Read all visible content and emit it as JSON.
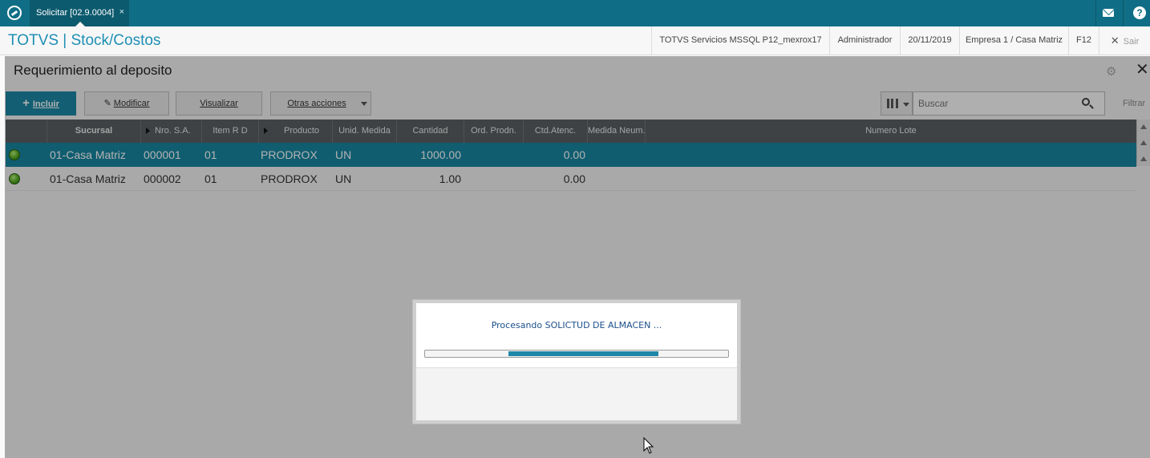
{
  "topbar": {
    "tab_label": "Solicitar [02.9.0004]",
    "tab_close": "×"
  },
  "header": {
    "app_title": "TOTVS | Stock/Costos",
    "environment": "TOTVS Servicios MSSQL P12_mexrox17",
    "user": "Administrador",
    "date": "20/11/2019",
    "company": "Empresa 1 / Casa Matriz",
    "shortcut": "F12",
    "exit_label": "Sair"
  },
  "page": {
    "title": "Requerimiento al deposito"
  },
  "toolbar": {
    "add_label": "Incluir",
    "modify_label": "Modificar",
    "view_label": "Visualizar",
    "more_label": "Otras acciones",
    "search_placeholder": "Buscar",
    "filter_label": "Filtrar"
  },
  "grid": {
    "columns": [
      "Sucursal",
      "Nro. S.A.",
      "Item R D",
      "Producto",
      "Unid. Medida",
      "Cantidad",
      "Ord. Prodn.",
      "Ctd.Atenc.",
      "Medida Neum.",
      "Numero Lote"
    ],
    "rows": [
      {
        "status": "green",
        "sucursal": "01-Casa Matriz",
        "nro": "000001",
        "item": "01",
        "producto": "PRODROX",
        "unid": "UN",
        "cantidad": "1000.00",
        "ord": "",
        "ctd": "0.00",
        "medida": "",
        "lote": ""
      },
      {
        "status": "green",
        "sucursal": "01-Casa Matriz",
        "nro": "000002",
        "item": "01",
        "producto": "PRODROX",
        "unid": "UN",
        "cantidad": "1.00",
        "ord": "",
        "ctd": "0.00",
        "medida": "",
        "lote": ""
      }
    ]
  },
  "dialog": {
    "message": "Procesando SOLICTUD DE ALMACEN ...",
    "progress_start": 0.276,
    "progress_end": 0.771
  },
  "colors": {
    "brand": "#0f6e86",
    "selected_row": "#1886a1",
    "title": "#1d8fb4",
    "progress": "#1f87a8"
  }
}
